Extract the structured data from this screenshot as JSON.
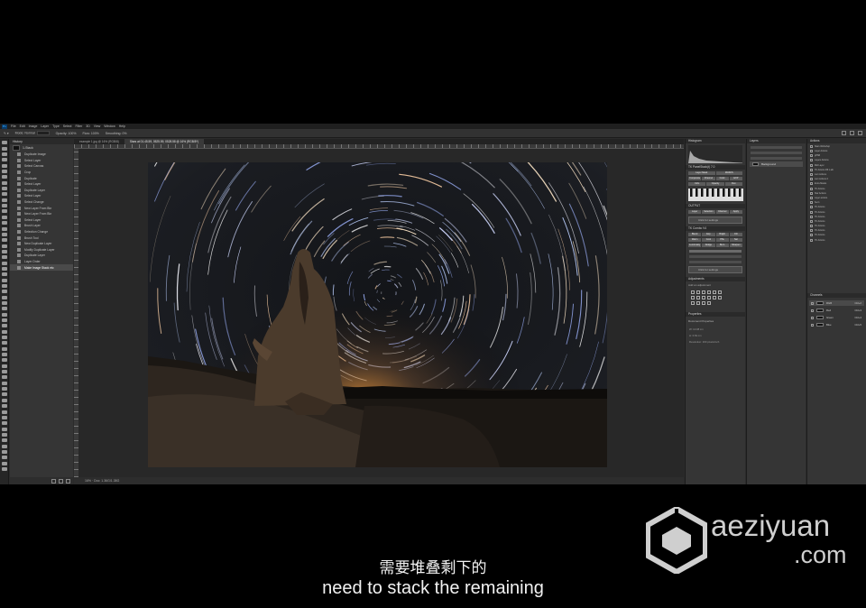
{
  "menu": {
    "logo": "Ps",
    "items": [
      "File",
      "Edit",
      "Image",
      "Layer",
      "Type",
      "Select",
      "Filter",
      "3D",
      "View",
      "Window",
      "Help"
    ]
  },
  "options": {
    "mode_label": "Mode:",
    "mode_value": "Normal",
    "opacity_label": "Opacity:",
    "opacity_value": "100%",
    "flow_label": "Flow:",
    "flow_value": "100%",
    "smoothing_label": "Smoothing:",
    "smoothing_value": "0%"
  },
  "history": {
    "tab": "History",
    "snapshot": "1-Stack",
    "items": [
      "Duplicate Image",
      "Select Layer",
      "Select Canvas",
      "Crop",
      "Duplicate",
      "Select Layer",
      "Duplicate Layer",
      "Select Layer",
      "Select Change",
      "New Layer From Bkr",
      "New Layer From Bkr",
      "Select Layer",
      "Brush Layer",
      "Selection Change",
      "Brush Tool",
      "New Duplicate Layer",
      "Modify Duplicate Layer",
      "Duplicate Layer",
      "Layer Order",
      "Make Image Stack etc"
    ],
    "active_index": 19
  },
  "document": {
    "tabs": [
      "example 1.jpg @ 16% (RGB/8)",
      "Stars at 01.45.59, 0525.59, 0528.58 @ 16% (RGB/8*)"
    ],
    "active_tab": 1,
    "status": "16% · Doc: 1.36G/1.38G"
  },
  "right_panels": {
    "histogram": "Histogram",
    "ext_title": "TK PanelStack(t) 7.0",
    "ext_tabs": [
      "Layer Mask",
      "MASKS"
    ],
    "ext_buttons_1": [
      "Composite",
      "Channel",
      "Color",
      "EXP"
    ],
    "ext_buttons_2": [
      "Ctrls",
      "Opacity",
      "Run"
    ],
    "output_head": "OUTPUT",
    "output_buttons": [
      "Layer",
      "Selection",
      "Channel",
      "Apply"
    ],
    "click_settings": "Click for settings",
    "module_title": "TK Combo V4",
    "module_buttons_1": [
      "Blend",
      "Exp",
      "Bright",
      "Fill"
    ],
    "module_buttons_2": [
      "Warm",
      "Cool",
      "HSL",
      "Sat"
    ],
    "module_buttons_3": [
      "Luminosity",
      "Dodge",
      "Burn",
      "Sharpen"
    ],
    "click_settings_2": "Click for settings",
    "adjustments": "Adjustments",
    "adjustments_sub": "Add an adjustment",
    "properties": "Properties",
    "properties_sub": "Document Properties",
    "prop_w": "W: 10.08 cm",
    "prop_h": "H: 6.69 cm",
    "prop_res": "Resolution: 300 pixels/inch",
    "layers": "Layers",
    "layer_name": "Background",
    "actions": "Actions",
    "action_items": [
      "Stars Workshop",
      "Layer Actions",
      "gPSB",
      "Layers Actions",
      "Mid Layer",
      "TK Actions Rfl 1 a/b",
      "Lum Actions",
      "Lum Actions 2",
      "Extra Masks",
      "TK Actions",
      "Star Actions",
      "Layer actions",
      "Set 1",
      "TK Actions",
      "TK Actions",
      "TK Actions",
      "TK Actions",
      "TK Actions",
      "TK Actions",
      "TK Actions",
      "TK Actions"
    ],
    "channels": "Channels",
    "channel_rows": [
      {
        "name": "RGB",
        "key": "Ctrl+2"
      },
      {
        "name": "Red",
        "key": "Ctrl+3"
      },
      {
        "name": "Green",
        "key": "Ctrl+4"
      },
      {
        "name": "Blue",
        "key": "Ctrl+5"
      }
    ]
  },
  "subtitles": {
    "zh": "需要堆叠剩下的",
    "en": "need to stack the remaining"
  },
  "watermark": {
    "text": "aeziyuan",
    "suffix": ".com"
  },
  "colors": {
    "app_bg": "#2b2b2b",
    "panel_bg": "#353535",
    "ps_blue": "#31a8ff",
    "horizon_glow": "#e8953a"
  }
}
